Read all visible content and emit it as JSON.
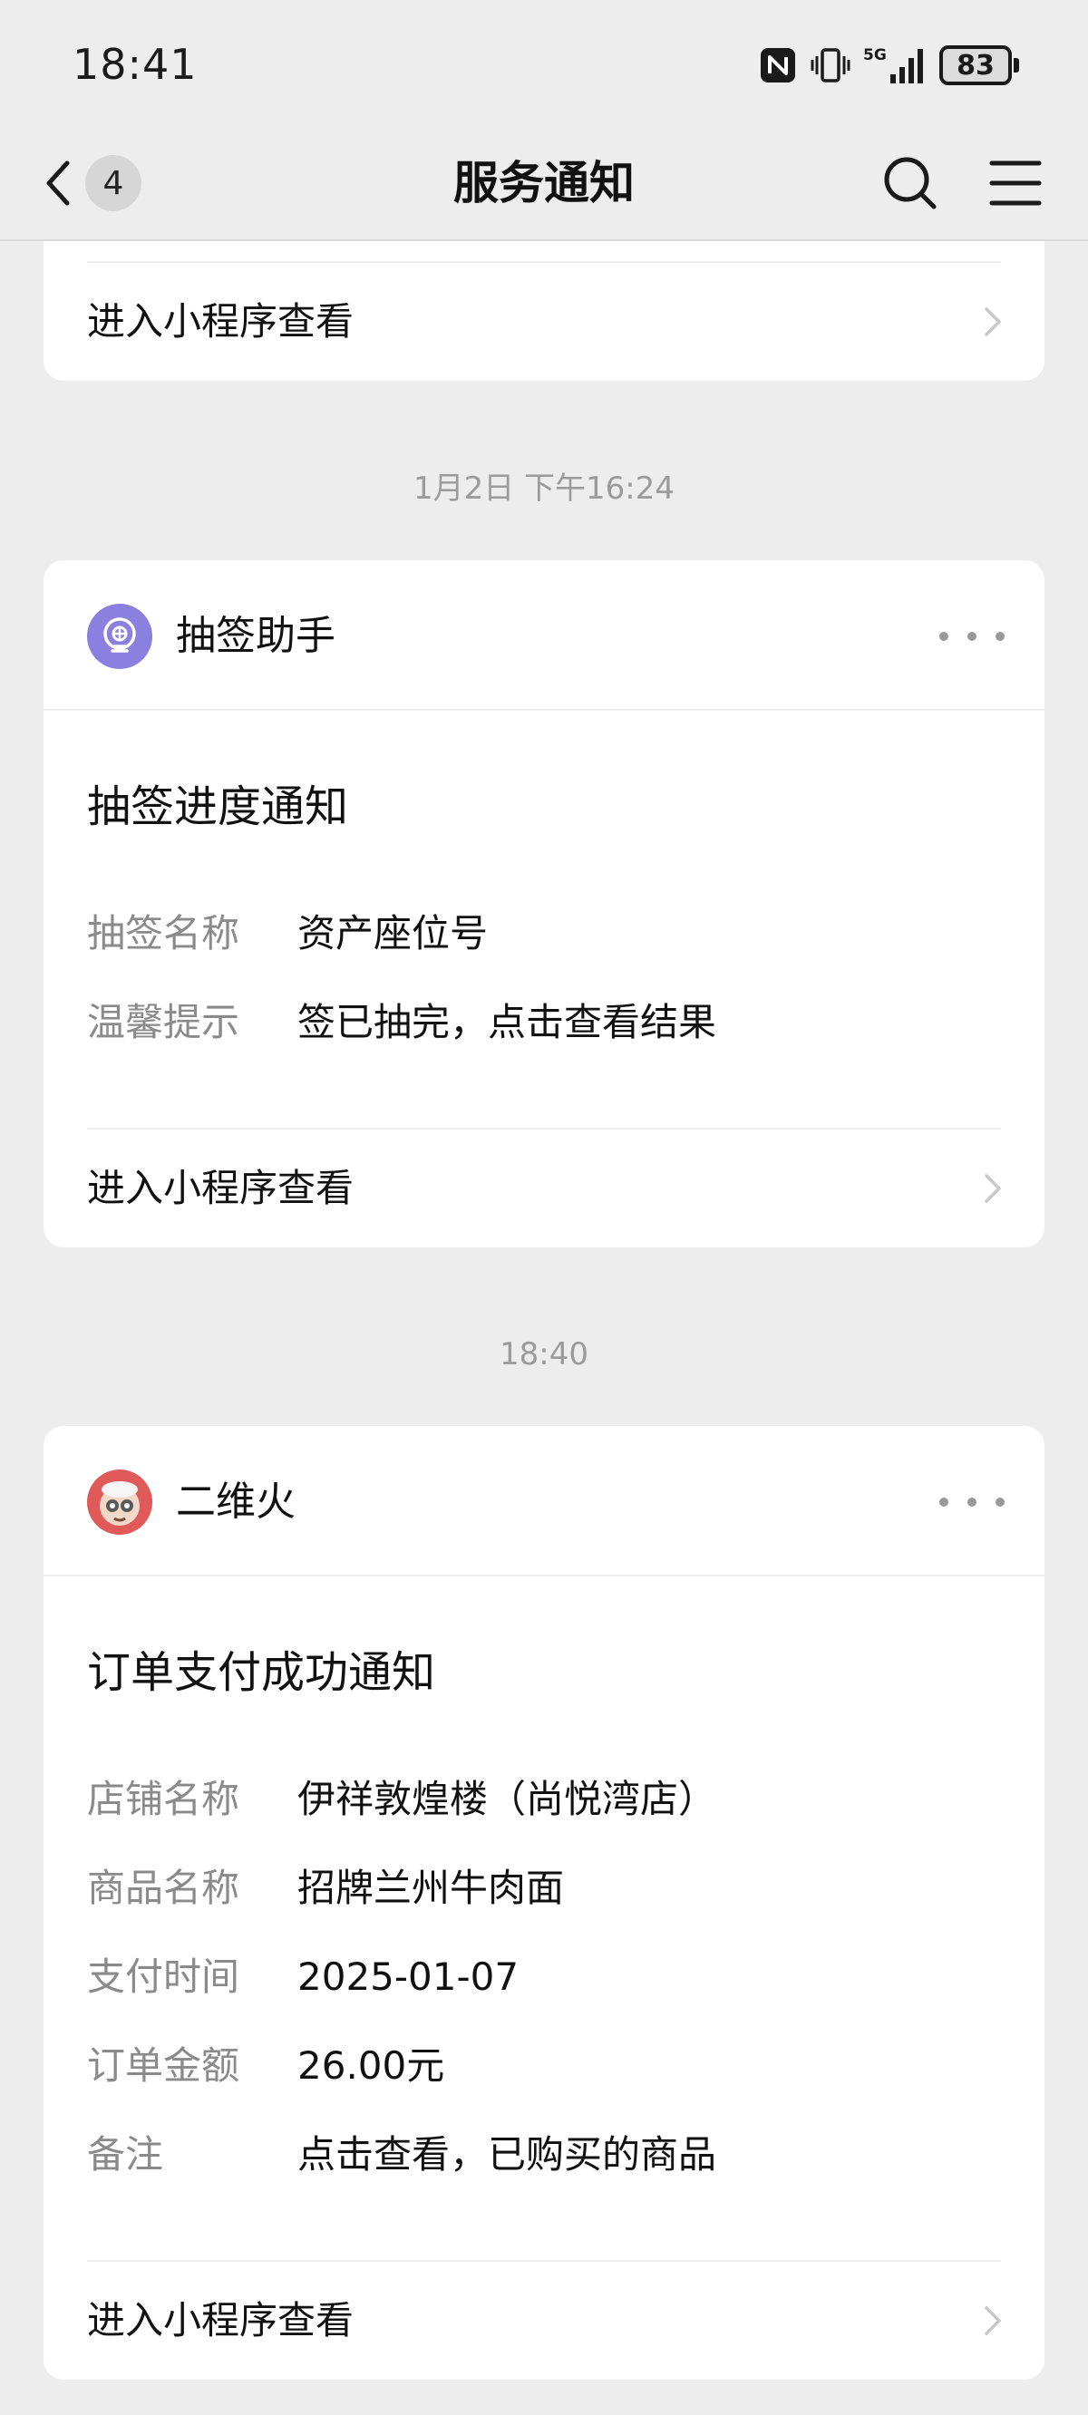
{
  "status_bar": {
    "time": "18:41",
    "battery": "83",
    "icons": [
      "nfc-icon",
      "vibrate-icon",
      "5g-signal-icon",
      "battery-icon"
    ]
  },
  "nav": {
    "title": "服务通知",
    "unread_count": "4",
    "icons": [
      "back-icon",
      "search-icon",
      "menu-icon"
    ]
  },
  "cards": [
    {
      "enter_label": "进入小程序查看"
    },
    {
      "timestamp": "1月2日 下午16:24",
      "app_name": "抽签助手",
      "title": "抽签进度通知",
      "fields": [
        {
          "label": "抽签名称",
          "value": "资产座位号"
        },
        {
          "label": "温馨提示",
          "value": "签已抽完，点击查看结果"
        }
      ],
      "enter_label": "进入小程序查看",
      "icon_color": "#8b7fe0"
    },
    {
      "timestamp": "18:40",
      "app_name": "二维火",
      "title": "订单支付成功通知",
      "fields": [
        {
          "label": "店铺名称",
          "value": "伊祥敦煌楼（尚悦湾店）"
        },
        {
          "label": "商品名称",
          "value": "招牌兰州牛肉面"
        },
        {
          "label": "支付时间",
          "value": "2025-01-07"
        },
        {
          "label": "订单金额",
          "value": "26.00元"
        },
        {
          "label": "备注",
          "value": "点击查看，已购买的商品"
        }
      ],
      "enter_label": "进入小程序查看",
      "icon_color": "#e05a5a"
    }
  ]
}
